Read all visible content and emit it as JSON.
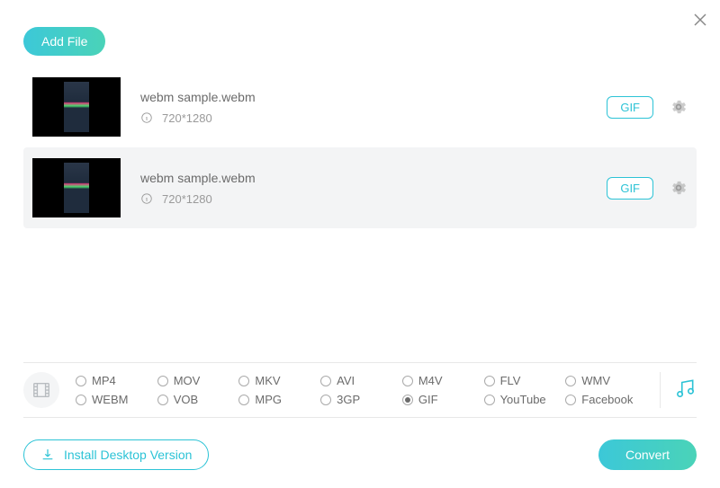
{
  "header": {
    "add_file_label": "Add File"
  },
  "files": [
    {
      "name": "webm sample.webm",
      "resolution": "720*1280",
      "badge": "GIF",
      "selected": false
    },
    {
      "name": "webm sample.webm",
      "resolution": "720*1280",
      "badge": "GIF",
      "selected": true
    }
  ],
  "formats": {
    "row1": [
      "MP4",
      "MOV",
      "MKV",
      "AVI",
      "M4V",
      "FLV",
      "WMV"
    ],
    "row2": [
      "WEBM",
      "VOB",
      "MPG",
      "3GP",
      "GIF",
      "YouTube",
      "Facebook"
    ],
    "selected": "GIF"
  },
  "footer": {
    "install_label": "Install Desktop Version",
    "convert_label": "Convert"
  }
}
